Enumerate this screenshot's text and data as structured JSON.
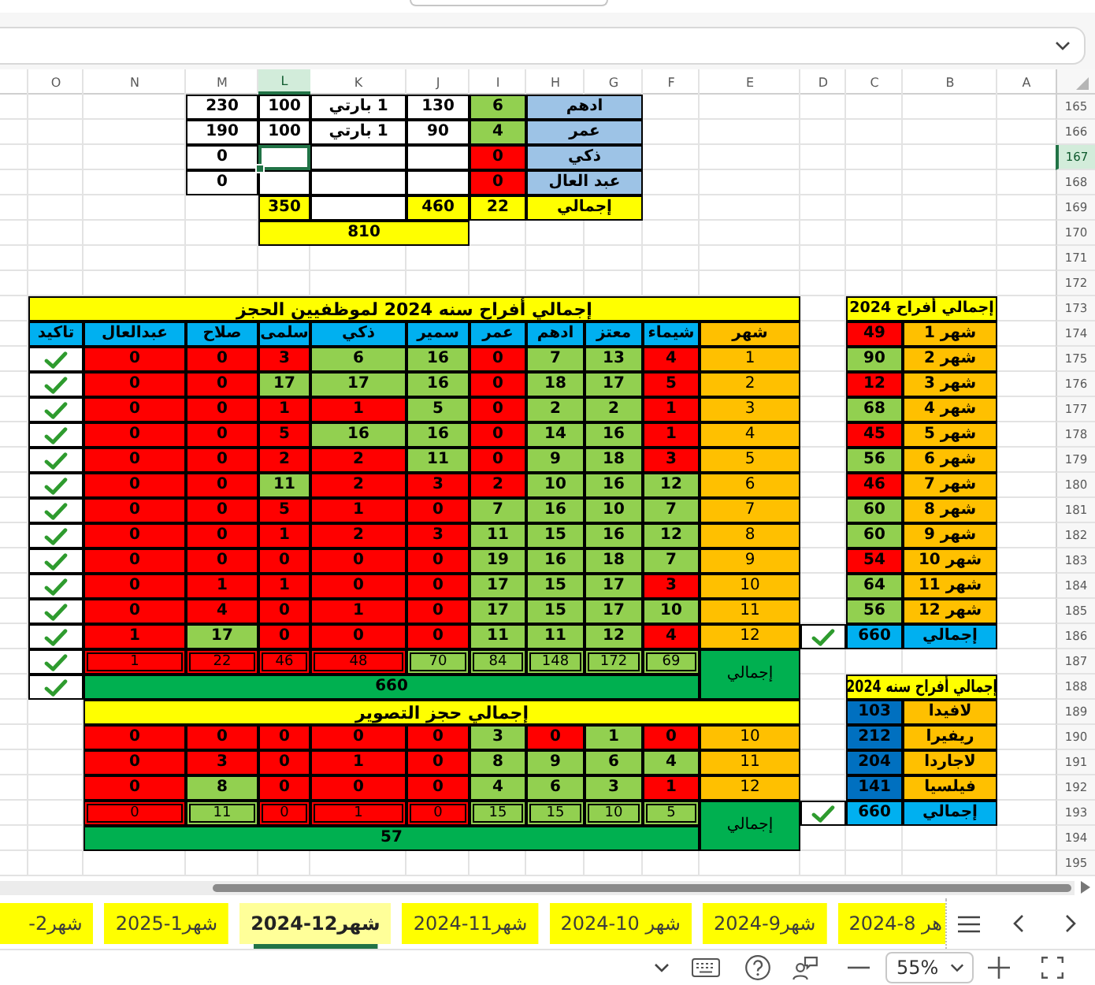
{
  "column_headers": [
    {
      "label": "A",
      "selected": false
    },
    {
      "label": "B",
      "selected": false
    },
    {
      "label": "C",
      "selected": false
    },
    {
      "label": "D",
      "selected": false
    },
    {
      "label": "E",
      "selected": false
    },
    {
      "label": "F",
      "selected": false
    },
    {
      "label": "G",
      "selected": false
    },
    {
      "label": "H",
      "selected": false
    },
    {
      "label": "I",
      "selected": false
    },
    {
      "label": "J",
      "selected": false
    },
    {
      "label": "K",
      "selected": false
    },
    {
      "label": "L",
      "selected": true
    },
    {
      "label": "M",
      "selected": false
    },
    {
      "label": "N",
      "selected": false
    },
    {
      "label": "O",
      "selected": false
    }
  ],
  "row_headers": [
    {
      "label": "165",
      "selected": false
    },
    {
      "label": "166",
      "selected": false
    },
    {
      "label": "167",
      "selected": true
    },
    {
      "label": "168",
      "selected": false
    },
    {
      "label": "169",
      "selected": false
    },
    {
      "label": "170",
      "selected": false
    },
    {
      "label": "171",
      "selected": false
    },
    {
      "label": "172",
      "selected": false
    },
    {
      "label": "173",
      "selected": false
    },
    {
      "label": "174",
      "selected": false
    },
    {
      "label": "175",
      "selected": false
    },
    {
      "label": "176",
      "selected": false
    },
    {
      "label": "177",
      "selected": false
    },
    {
      "label": "178",
      "selected": false
    },
    {
      "label": "179",
      "selected": false
    },
    {
      "label": "180",
      "selected": false
    },
    {
      "label": "181",
      "selected": false
    },
    {
      "label": "182",
      "selected": false
    },
    {
      "label": "183",
      "selected": false
    },
    {
      "label": "184",
      "selected": false
    },
    {
      "label": "185",
      "selected": false
    },
    {
      "label": "186",
      "selected": false
    },
    {
      "label": "187",
      "selected": false
    },
    {
      "label": "188",
      "selected": false
    },
    {
      "label": "189",
      "selected": false
    },
    {
      "label": "190",
      "selected": false
    },
    {
      "label": "191",
      "selected": false
    },
    {
      "label": "192",
      "selected": false
    },
    {
      "label": "193",
      "selected": false
    },
    {
      "label": "194",
      "selected": false
    },
    {
      "label": "195",
      "selected": false
    }
  ],
  "staff_summary": {
    "rows": [
      {
        "name": "ادهم",
        "column_2": {
          "value": "6",
          "color": "#92d050"
        },
        "column_3": "130",
        "column_4": "1 بارتي",
        "column_5": "100",
        "column_6": "230"
      },
      {
        "name": "عمر",
        "column_2": {
          "value": "4",
          "color": "#92d050"
        },
        "column_3": "90",
        "column_4": "1 بارتي",
        "column_5": "100",
        "column_6": "190"
      },
      {
        "name": "ذكي",
        "column_2": {
          "value": "0",
          "color": "#ff0000"
        },
        "column_6": "0"
      },
      {
        "name": "عبد العال",
        "column_2": {
          "value": "0",
          "color": "#ff0000"
        },
        "column_6": "0"
      }
    ],
    "total": {
      "label": "إجمالي",
      "column_2": "22",
      "column_3": "460",
      "column_5": "350"
    },
    "grand_total": "810"
  },
  "monthly_totals": {
    "title": "إجمالي أفراح 2024",
    "rows": [
      {
        "month": "شهر 1",
        "value": "49",
        "color": "#ff0000"
      },
      {
        "month": "شهر 2",
        "value": "90",
        "color": "#92d050"
      },
      {
        "month": "شهر 3",
        "value": "12",
        "color": "#ff0000"
      },
      {
        "month": "شهر 4",
        "value": "68",
        "color": "#92d050"
      },
      {
        "month": "شهر 5",
        "value": "45",
        "color": "#ff0000"
      },
      {
        "month": "شهر 6",
        "value": "56",
        "color": "#92d050"
      },
      {
        "month": "شهر 7",
        "value": "46",
        "color": "#ff0000"
      },
      {
        "month": "شهر 8",
        "value": "60",
        "color": "#92d050"
      },
      {
        "month": "شهر 9",
        "value": "60",
        "color": "#92d050"
      },
      {
        "month": "شهر 10",
        "value": "54",
        "color": "#ff0000"
      },
      {
        "month": "شهر 11",
        "value": "64",
        "color": "#92d050"
      },
      {
        "month": "شهر 12",
        "value": "56",
        "color": "#92d050"
      }
    ],
    "total": {
      "label": "إجمالي",
      "value": "660",
      "confirmed": true
    }
  },
  "bookings_2024": {
    "title": "إجمالي أفراح سنه 2024 لموظفيين الحجز",
    "columns": [
      "شهر",
      "شيماء",
      "معتز",
      "ادهم",
      "عمر",
      "سمير",
      "ذكي",
      "سلمى",
      "صلاح",
      "عبدالعال",
      "تاكيد"
    ],
    "rows": [
      {
        "cells": [
          {
            "value": "1"
          },
          {
            "value": "4",
            "color": "#ff0000"
          },
          {
            "value": "13",
            "color": "#92d050"
          },
          {
            "value": "7",
            "color": "#92d050"
          },
          {
            "value": "0",
            "color": "#ff0000"
          },
          {
            "value": "16",
            "color": "#92d050"
          },
          {
            "value": "6",
            "color": "#92d050"
          },
          {
            "value": "3",
            "color": "#ff0000"
          },
          {
            "value": "0",
            "color": "#ff0000"
          },
          {
            "value": "0",
            "color": "#ff0000"
          }
        ],
        "confirmed": true
      },
      {
        "cells": [
          {
            "value": "2"
          },
          {
            "value": "5",
            "color": "#ff0000"
          },
          {
            "value": "17",
            "color": "#92d050"
          },
          {
            "value": "18",
            "color": "#92d050"
          },
          {
            "value": "0",
            "color": "#ff0000"
          },
          {
            "value": "16",
            "color": "#92d050"
          },
          {
            "value": "17",
            "color": "#92d050"
          },
          {
            "value": "17",
            "color": "#92d050"
          },
          {
            "value": "0",
            "color": "#ff0000"
          },
          {
            "value": "0",
            "color": "#ff0000"
          }
        ],
        "confirmed": true
      },
      {
        "cells": [
          {
            "value": "3"
          },
          {
            "value": "1",
            "color": "#ff0000"
          },
          {
            "value": "2",
            "color": "#92d050"
          },
          {
            "value": "2",
            "color": "#92d050"
          },
          {
            "value": "0",
            "color": "#ff0000"
          },
          {
            "value": "5",
            "color": "#92d050"
          },
          {
            "value": "1",
            "color": "#ff0000"
          },
          {
            "value": "1",
            "color": "#ff0000"
          },
          {
            "value": "0",
            "color": "#ff0000"
          },
          {
            "value": "0",
            "color": "#ff0000"
          }
        ],
        "confirmed": true
      },
      {
        "cells": [
          {
            "value": "4"
          },
          {
            "value": "1",
            "color": "#ff0000"
          },
          {
            "value": "16",
            "color": "#92d050"
          },
          {
            "value": "14",
            "color": "#92d050"
          },
          {
            "value": "0",
            "color": "#ff0000"
          },
          {
            "value": "16",
            "color": "#92d050"
          },
          {
            "value": "16",
            "color": "#92d050"
          },
          {
            "value": "5",
            "color": "#ff0000"
          },
          {
            "value": "0",
            "color": "#ff0000"
          },
          {
            "value": "0",
            "color": "#ff0000"
          }
        ],
        "confirmed": true
      },
      {
        "cells": [
          {
            "value": "5"
          },
          {
            "value": "3",
            "color": "#ff0000"
          },
          {
            "value": "18",
            "color": "#92d050"
          },
          {
            "value": "9",
            "color": "#92d050"
          },
          {
            "value": "0",
            "color": "#ff0000"
          },
          {
            "value": "11",
            "color": "#92d050"
          },
          {
            "value": "2",
            "color": "#ff0000"
          },
          {
            "value": "2",
            "color": "#ff0000"
          },
          {
            "value": "0",
            "color": "#ff0000"
          },
          {
            "value": "0",
            "color": "#ff0000"
          }
        ],
        "confirmed": true
      },
      {
        "cells": [
          {
            "value": "6"
          },
          {
            "value": "12",
            "color": "#92d050"
          },
          {
            "value": "16",
            "color": "#92d050"
          },
          {
            "value": "10",
            "color": "#92d050"
          },
          {
            "value": "2",
            "color": "#ff0000"
          },
          {
            "value": "3",
            "color": "#ff0000"
          },
          {
            "value": "2",
            "color": "#ff0000"
          },
          {
            "value": "11",
            "color": "#92d050"
          },
          {
            "value": "0",
            "color": "#ff0000"
          },
          {
            "value": "0",
            "color": "#ff0000"
          }
        ],
        "confirmed": true
      },
      {
        "cells": [
          {
            "value": "7"
          },
          {
            "value": "7",
            "color": "#92d050"
          },
          {
            "value": "10",
            "color": "#92d050"
          },
          {
            "value": "16",
            "color": "#92d050"
          },
          {
            "value": "7",
            "color": "#92d050"
          },
          {
            "value": "0",
            "color": "#ff0000"
          },
          {
            "value": "1",
            "color": "#ff0000"
          },
          {
            "value": "5",
            "color": "#ff0000"
          },
          {
            "value": "0",
            "color": "#ff0000"
          },
          {
            "value": "0",
            "color": "#ff0000"
          }
        ],
        "confirmed": true
      },
      {
        "cells": [
          {
            "value": "8"
          },
          {
            "value": "12",
            "color": "#92d050"
          },
          {
            "value": "16",
            "color": "#92d050"
          },
          {
            "value": "15",
            "color": "#92d050"
          },
          {
            "value": "11",
            "color": "#92d050"
          },
          {
            "value": "3",
            "color": "#ff0000"
          },
          {
            "value": "2",
            "color": "#ff0000"
          },
          {
            "value": "1",
            "color": "#ff0000"
          },
          {
            "value": "0",
            "color": "#ff0000"
          },
          {
            "value": "0",
            "color": "#ff0000"
          }
        ],
        "confirmed": true
      },
      {
        "cells": [
          {
            "value": "9"
          },
          {
            "value": "7",
            "color": "#92d050"
          },
          {
            "value": "18",
            "color": "#92d050"
          },
          {
            "value": "16",
            "color": "#92d050"
          },
          {
            "value": "19",
            "color": "#92d050"
          },
          {
            "value": "0",
            "color": "#ff0000"
          },
          {
            "value": "0",
            "color": "#ff0000"
          },
          {
            "value": "0",
            "color": "#ff0000"
          },
          {
            "value": "0",
            "color": "#ff0000"
          },
          {
            "value": "0",
            "color": "#ff0000"
          }
        ],
        "confirmed": true
      },
      {
        "cells": [
          {
            "value": "10"
          },
          {
            "value": "3",
            "color": "#ff0000"
          },
          {
            "value": "17",
            "color": "#92d050"
          },
          {
            "value": "15",
            "color": "#92d050"
          },
          {
            "value": "17",
            "color": "#92d050"
          },
          {
            "value": "0",
            "color": "#ff0000"
          },
          {
            "value": "0",
            "color": "#ff0000"
          },
          {
            "value": "1",
            "color": "#ff0000"
          },
          {
            "value": "1",
            "color": "#ff0000"
          },
          {
            "value": "0",
            "color": "#ff0000"
          }
        ],
        "confirmed": true
      },
      {
        "cells": [
          {
            "value": "11"
          },
          {
            "value": "10",
            "color": "#92d050"
          },
          {
            "value": "17",
            "color": "#92d050"
          },
          {
            "value": "15",
            "color": "#92d050"
          },
          {
            "value": "17",
            "color": "#92d050"
          },
          {
            "value": "0",
            "color": "#ff0000"
          },
          {
            "value": "1",
            "color": "#ff0000"
          },
          {
            "value": "0",
            "color": "#ff0000"
          },
          {
            "value": "4",
            "color": "#ff0000"
          },
          {
            "value": "0",
            "color": "#ff0000"
          }
        ],
        "confirmed": true
      },
      {
        "cells": [
          {
            "value": "12"
          },
          {
            "value": "4",
            "color": "#ff0000"
          },
          {
            "value": "12",
            "color": "#92d050"
          },
          {
            "value": "11",
            "color": "#92d050"
          },
          {
            "value": "11",
            "color": "#92d050"
          },
          {
            "value": "0",
            "color": "#ff0000"
          },
          {
            "value": "0",
            "color": "#ff0000"
          },
          {
            "value": "0",
            "color": "#ff0000"
          },
          {
            "value": "17",
            "color": "#92d050"
          },
          {
            "value": "1",
            "color": "#ff0000"
          }
        ],
        "confirmed": true
      }
    ],
    "totals": {
      "cells": [
        {
          "value": "إجمالي"
        },
        {
          "value": "69",
          "color": "#92d050"
        },
        {
          "value": "172",
          "color": "#92d050"
        },
        {
          "value": "148",
          "color": "#92d050"
        },
        {
          "value": "84",
          "color": "#92d050"
        },
        {
          "value": "70",
          "color": "#92d050"
        },
        {
          "value": "48",
          "color": "#ff0000"
        },
        {
          "value": "46",
          "color": "#ff0000"
        },
        {
          "value": "22",
          "color": "#ff0000"
        },
        {
          "value": "1",
          "color": "#ff0000"
        }
      ],
      "confirmed": true
    },
    "grand_total": {
      "value": "660",
      "confirmed": true
    }
  },
  "venues": {
    "title": "إجمالي أفراح سنه 2024",
    "rows": [
      {
        "name": "لافيدا",
        "value": "103"
      },
      {
        "name": "ريفيرا",
        "value": "212"
      },
      {
        "name": "لاجاردا",
        "value": "204"
      },
      {
        "name": "فيلسيا",
        "value": "141"
      }
    ],
    "total": {
      "label": "إجمالي",
      "value": "660",
      "confirmed": true
    }
  },
  "photography": {
    "title": "إجمالي حجز التصوير",
    "rows": [
      {
        "cells": [
          {
            "value": "10"
          },
          {
            "value": "0",
            "color": "#ff0000"
          },
          {
            "value": "1",
            "color": "#92d050"
          },
          {
            "value": "0",
            "color": "#ff0000"
          },
          {
            "value": "3",
            "color": "#92d050"
          },
          {
            "value": "0",
            "color": "#ff0000"
          },
          {
            "value": "0",
            "color": "#ff0000"
          },
          {
            "value": "0",
            "color": "#ff0000"
          },
          {
            "value": "0",
            "color": "#ff0000"
          },
          {
            "value": "0",
            "color": "#ff0000"
          }
        ]
      },
      {
        "cells": [
          {
            "value": "11"
          },
          {
            "value": "4",
            "color": "#92d050"
          },
          {
            "value": "6",
            "color": "#92d050"
          },
          {
            "value": "9",
            "color": "#92d050"
          },
          {
            "value": "8",
            "color": "#92d050"
          },
          {
            "value": "0",
            "color": "#ff0000"
          },
          {
            "value": "1",
            "color": "#ff0000"
          },
          {
            "value": "0",
            "color": "#ff0000"
          },
          {
            "value": "3",
            "color": "#ff0000"
          },
          {
            "value": "0",
            "color": "#ff0000"
          }
        ]
      },
      {
        "cells": [
          {
            "value": "12"
          },
          {
            "value": "1",
            "color": "#ff0000"
          },
          {
            "value": "3",
            "color": "#92d050"
          },
          {
            "value": "6",
            "color": "#92d050"
          },
          {
            "value": "4",
            "color": "#92d050"
          },
          {
            "value": "0",
            "color": "#ff0000"
          },
          {
            "value": "0",
            "color": "#ff0000"
          },
          {
            "value": "0",
            "color": "#ff0000"
          },
          {
            "value": "8",
            "color": "#92d050"
          },
          {
            "value": "0",
            "color": "#ff0000"
          }
        ]
      }
    ],
    "totals": {
      "cells": [
        {
          "value": "إجمالي"
        },
        {
          "value": "5",
          "color": "#92d050"
        },
        {
          "value": "10",
          "color": "#92d050"
        },
        {
          "value": "15",
          "color": "#92d050"
        },
        {
          "value": "15",
          "color": "#92d050"
        },
        {
          "value": "0",
          "color": "#ff0000"
        },
        {
          "value": "1",
          "color": "#ff0000"
        },
        {
          "value": "0",
          "color": "#ff0000"
        },
        {
          "value": "11",
          "color": "#92d050"
        },
        {
          "value": "0",
          "color": "#ff0000"
        }
      ]
    },
    "grand_total": {
      "value": "57"
    }
  },
  "sheet_tabs": [
    {
      "label": "هر 8-2024",
      "selected": false
    },
    {
      "label": "شهر9-2024",
      "selected": false
    },
    {
      "label": "شهر 10-2024",
      "selected": false
    },
    {
      "label": "شهر11-2024",
      "selected": false
    },
    {
      "label": "شهر12-2024",
      "selected": true
    },
    {
      "label": "شهر1-2025",
      "selected": false
    },
    {
      "label": "شهر2-",
      "selected": false
    }
  ],
  "status_bar": {
    "zoom": "55%"
  }
}
